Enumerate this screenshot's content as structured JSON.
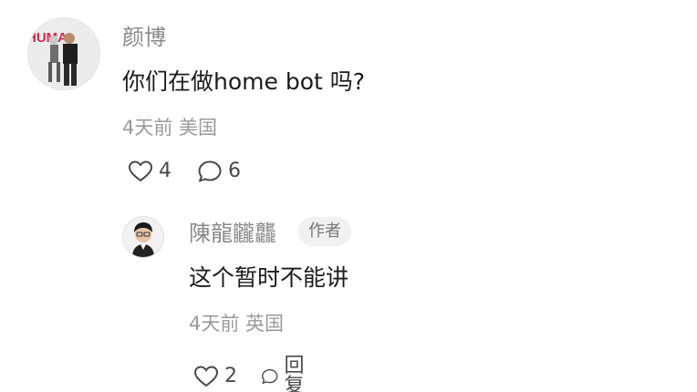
{
  "comments": [
    {
      "author": "颜博",
      "text": "你们在做home bot 吗?",
      "meta": "4天前 美国",
      "likes": "4",
      "replies": "6",
      "avatar_text": "HUMA"
    }
  ],
  "reply": {
    "author": "陳龍龖龘",
    "badge": "作者",
    "text": "这个暂时不能讲",
    "meta": "4天前 英国",
    "likes": "2",
    "reply_label": "回复"
  },
  "icons": {
    "like": "heart-outline-icon",
    "comment": "speech-bubble-icon"
  },
  "colors": {
    "name": "#8a8a8a",
    "text": "#1c1c1c",
    "meta": "#9a9a9a",
    "badge_bg": "#f1f1f1"
  }
}
